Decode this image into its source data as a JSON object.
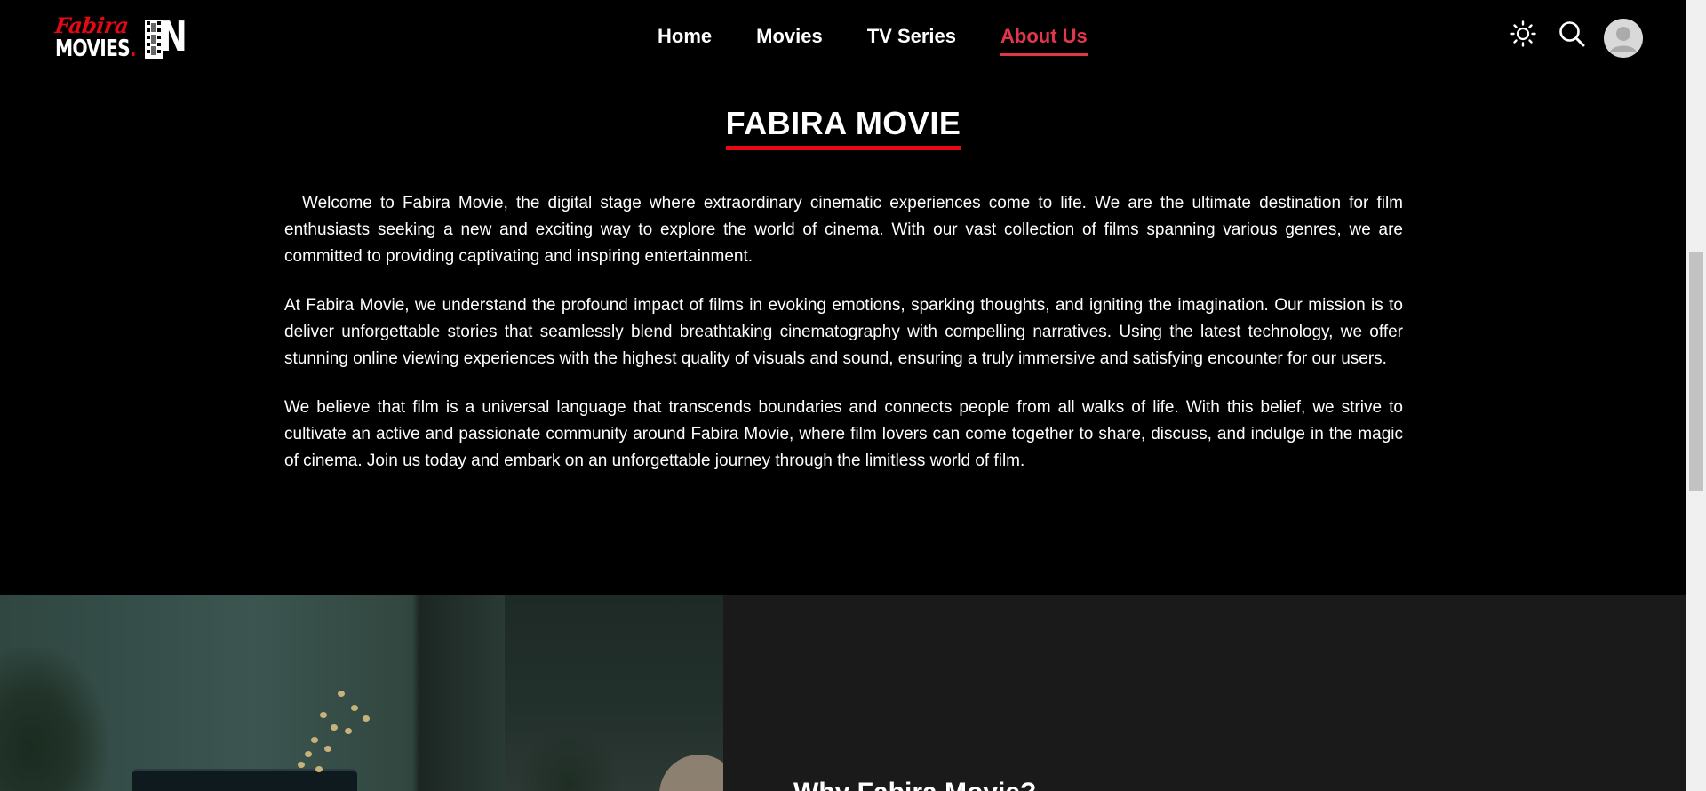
{
  "header": {
    "logo": {
      "top_text": "Fabira",
      "bottom_text": "MOVIES",
      "dot": ".",
      "suffix": "IN"
    },
    "nav": [
      {
        "label": "Home",
        "active": false
      },
      {
        "label": "Movies",
        "active": false
      },
      {
        "label": "TV Series",
        "active": false
      },
      {
        "label": "About Us",
        "active": true
      }
    ],
    "icons": [
      "sun-icon",
      "search-icon",
      "avatar"
    ]
  },
  "about": {
    "title": "FABIRA MOVIE",
    "paragraphs": [
      "Welcome to Fabira Movie, the digital stage where extraordinary cinematic experiences come to life. We are the ultimate destination for film enthusiasts seeking a new and exciting way to explore the world of cinema. With our vast collection of films spanning various genres, we are committed to providing captivating and inspiring entertainment.",
      "At Fabira Movie, we understand the profound impact of films in evoking emotions, sparking thoughts, and igniting the imagination. Our mission is to deliver unforgettable stories that seamlessly blend breathtaking cinematography with compelling narratives. Using the latest technology, we offer stunning online viewing experiences with the highest quality of visuals and sound, ensuring a truly immersive and satisfying encounter for our users.",
      "We believe that film is a universal language that transcends boundaries and connects people from all walks of life. With this belief, we strive to cultivate an active and passionate community around Fabira Movie, where film lovers can come together to share, discuss, and indulge in the magic of cinema. Join us today and embark on an unforgettable journey through the limitless world of film."
    ]
  },
  "why": {
    "title": "Why Fabira Movie?"
  },
  "colors": {
    "accent": "#e50914",
    "nav_active": "#e0384a",
    "background": "#000000",
    "section_bg": "#1a1a1a"
  }
}
